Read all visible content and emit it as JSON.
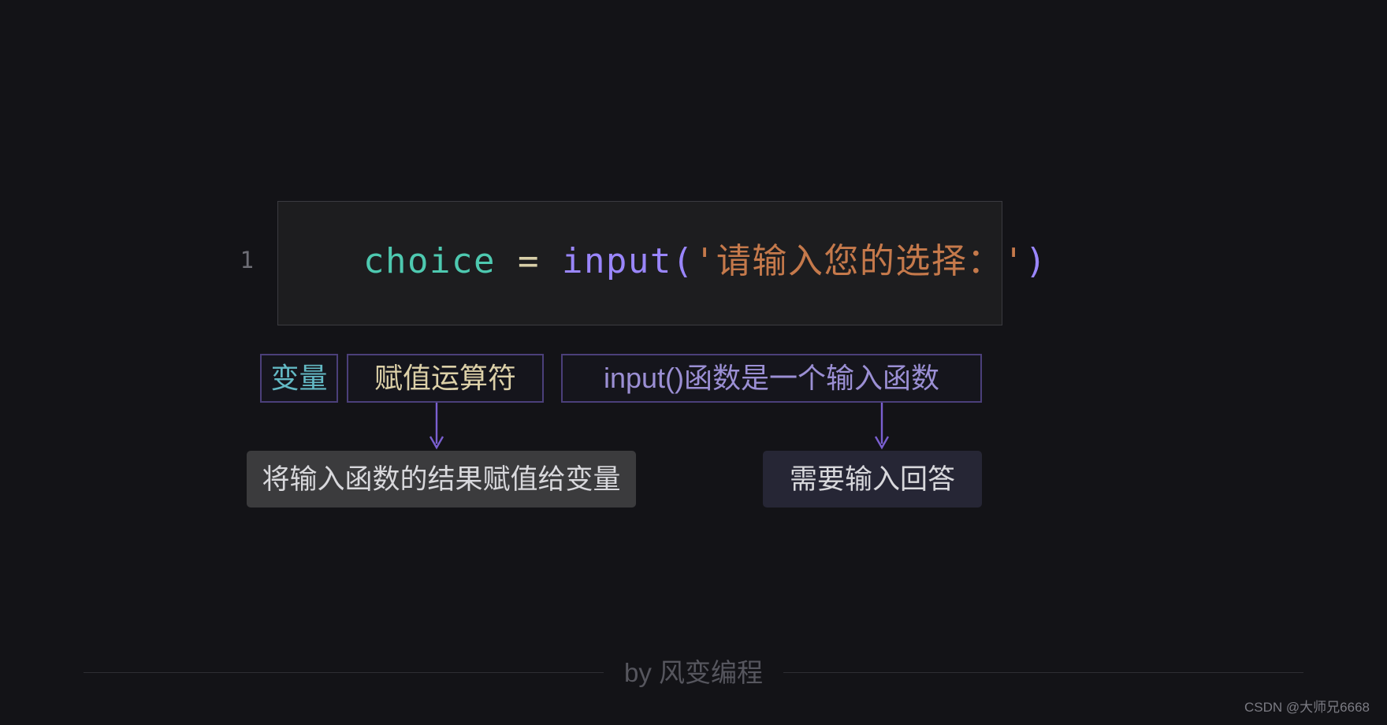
{
  "code": {
    "line_number": "1",
    "tokens": [
      {
        "text": "choice",
        "kind": "variable"
      },
      {
        "text": " ",
        "kind": "space"
      },
      {
        "text": "=",
        "kind": "operator"
      },
      {
        "text": "  ",
        "kind": "space"
      },
      {
        "text": "input",
        "kind": "function"
      },
      {
        "text": "(",
        "kind": "paren"
      },
      {
        "text": "'请输入您的选择：'",
        "kind": "string"
      },
      {
        "text": ")",
        "kind": "paren"
      }
    ],
    "full_text": "choice =  input('请输入您的选择：')",
    "colors": {
      "variable": "#4ec9b0",
      "operator": "#d8cfa8",
      "function": "#9a86fd",
      "paren": "#9a86fd",
      "string": "#c5794b",
      "line_number": "#6e6e76",
      "panel_background": "#1d1d1f",
      "panel_border": "#3b3b40"
    }
  },
  "annotations": {
    "labels": [
      {
        "id": "variable",
        "text": "变量",
        "color": "#63b9c4"
      },
      {
        "id": "assignment-operator",
        "text": "赋值运算符",
        "color": "#dcd0a8"
      },
      {
        "id": "input-function",
        "text": "input()函数是一个输入函数",
        "color": "#9b8fd4"
      }
    ],
    "label_border_color": "#4b3f7a",
    "descriptions": [
      {
        "id": "assignment",
        "text": "将输入函数的结果赋值给变量",
        "background": "#3b3b3d"
      },
      {
        "id": "input",
        "text": "需要输入回答",
        "background": "#262635"
      }
    ],
    "arrow_color": "#7a5fd0"
  },
  "footer": {
    "text": "by 风变编程"
  },
  "watermark": {
    "text": "CSDN @大师兄6668"
  }
}
